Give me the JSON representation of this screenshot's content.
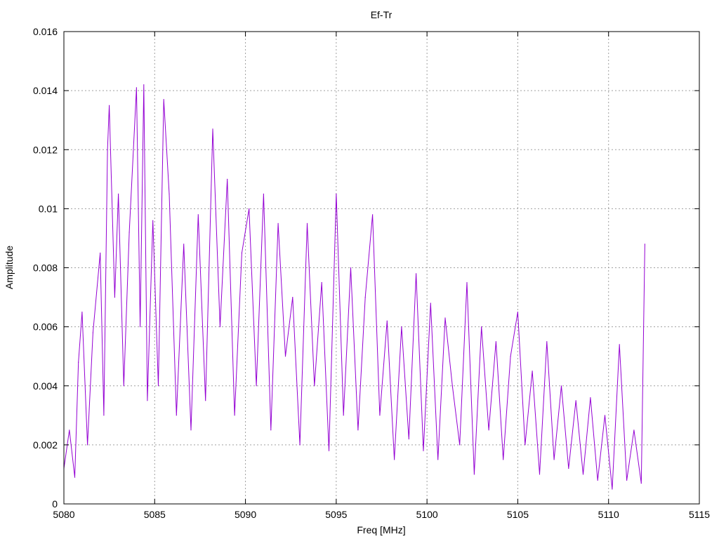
{
  "chart_data": {
    "type": "line",
    "title": "Ef-Tr",
    "xlabel": "Freq [MHz]",
    "ylabel": "Amplitude",
    "xlim": [
      5080,
      5115
    ],
    "ylim": [
      0,
      0.016
    ],
    "xticks": [
      5080,
      5085,
      5090,
      5095,
      5100,
      5105,
      5110,
      5115
    ],
    "xtick_labels": [
      "5080",
      "5085",
      "5090",
      "5095",
      "5100",
      "5105",
      "5110",
      "5115"
    ],
    "yticks": [
      0,
      0.002,
      0.004,
      0.006,
      0.008,
      0.01,
      0.012,
      0.014,
      0.016
    ],
    "ytick_labels": [
      "0",
      "0.002",
      "0.004",
      "0.006",
      "0.008",
      "0.01",
      "0.012",
      "0.014",
      "0.016"
    ],
    "grid": true,
    "legend": "none",
    "line_color": "#9400d3",
    "series": [
      {
        "x": [
          5080.0,
          5080.3,
          5080.6,
          5080.8,
          5081.0,
          5081.3,
          5081.6,
          5082.0,
          5082.2,
          5082.4,
          5082.5,
          5082.8,
          5083.0,
          5083.3,
          5083.6,
          5084.0,
          5084.2,
          5084.4,
          5084.6,
          5084.9,
          5085.2,
          5085.5,
          5085.8,
          5086.2,
          5086.6,
          5087.0,
          5087.4,
          5087.8,
          5088.2,
          5088.6,
          5089.0,
          5089.4,
          5089.8,
          5090.2,
          5090.6,
          5091.0,
          5091.4,
          5091.8,
          5092.2,
          5092.6,
          5093.0,
          5093.4,
          5093.8,
          5094.2,
          5094.6,
          5095.0,
          5095.4,
          5095.8,
          5096.2,
          5096.6,
          5097.0,
          5097.4,
          5097.8,
          5098.2,
          5098.6,
          5099.0,
          5099.4,
          5099.8,
          5100.2,
          5100.6,
          5101.0,
          5101.4,
          5101.8,
          5102.2,
          5102.6,
          5103.0,
          5103.4,
          5103.8,
          5104.2,
          5104.6,
          5105.0,
          5105.4,
          5105.8,
          5106.2,
          5106.6,
          5107.0,
          5107.4,
          5107.8,
          5108.2,
          5108.6,
          5109.0,
          5109.4,
          5109.8,
          5110.2,
          5110.6,
          5111.0,
          5111.4,
          5111.8,
          5112.0
        ],
        "values": [
          0.0012,
          0.0025,
          0.0009,
          0.0048,
          0.0065,
          0.002,
          0.0058,
          0.0085,
          0.003,
          0.012,
          0.0135,
          0.007,
          0.0105,
          0.004,
          0.0092,
          0.0141,
          0.006,
          0.0142,
          0.0035,
          0.0096,
          0.004,
          0.0137,
          0.0105,
          0.003,
          0.0088,
          0.0025,
          0.0098,
          0.0035,
          0.0127,
          0.006,
          0.011,
          0.003,
          0.0085,
          0.01,
          0.004,
          0.0105,
          0.0025,
          0.0095,
          0.005,
          0.007,
          0.002,
          0.0095,
          0.004,
          0.0075,
          0.0018,
          0.0105,
          0.003,
          0.008,
          0.0025,
          0.007,
          0.0098,
          0.003,
          0.0062,
          0.0015,
          0.006,
          0.0022,
          0.0078,
          0.0018,
          0.0068,
          0.0015,
          0.0063,
          0.004,
          0.002,
          0.0075,
          0.001,
          0.006,
          0.0025,
          0.0055,
          0.0015,
          0.005,
          0.0065,
          0.002,
          0.0045,
          0.001,
          0.0055,
          0.0015,
          0.004,
          0.0012,
          0.0035,
          0.001,
          0.0036,
          0.0008,
          0.003,
          0.0005,
          0.0054,
          0.0008,
          0.0025,
          0.0007,
          0.0088
        ]
      }
    ]
  }
}
